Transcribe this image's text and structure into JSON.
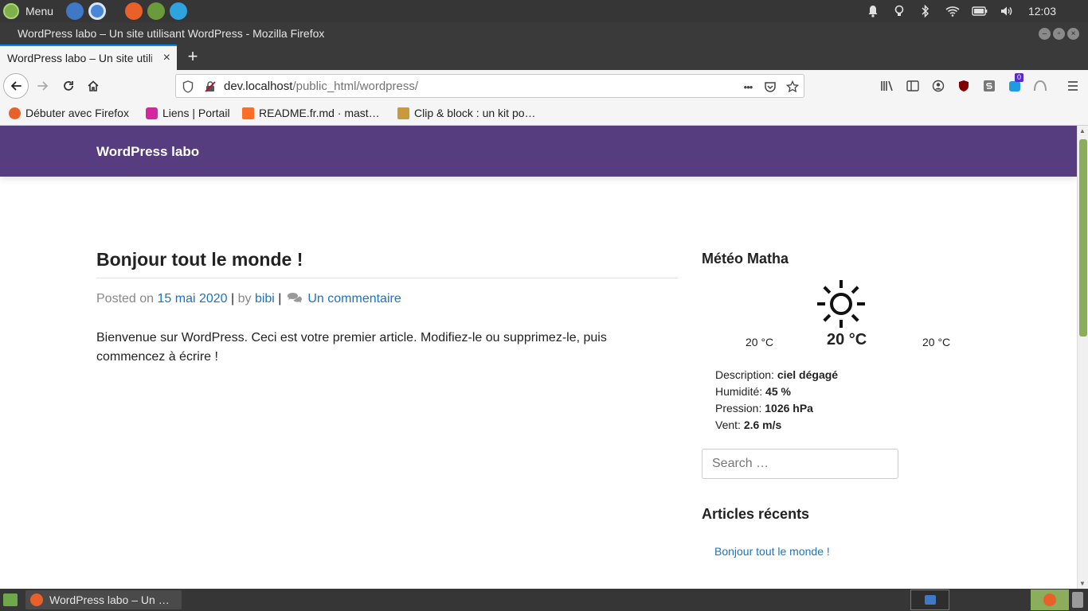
{
  "system_panel": {
    "menu_label": "Menu",
    "clock": "12:03"
  },
  "window": {
    "title": "WordPress labo – Un site utilisant WordPress - Mozilla Firefox"
  },
  "tabs": [
    {
      "label": "WordPress labo – Un site utilisant WordPress",
      "close": "×"
    }
  ],
  "new_tab_label": "+",
  "urlbar": {
    "host": "dev.localhost",
    "path": "/public_html/wordpress/",
    "more": "•••"
  },
  "bookmarks": [
    {
      "label": "Débuter avec Firefox"
    },
    {
      "label": "Liens | Portail"
    },
    {
      "label": "README.fr.md · mast…"
    },
    {
      "label": "Clip & block : un kit po…"
    }
  ],
  "toolbar": {
    "notification_badge": "0"
  },
  "site": {
    "title": "WordPress labo"
  },
  "post": {
    "title": "Bonjour tout le monde !",
    "meta_posted_on": "Posted on ",
    "date": "15 mai 2020",
    "meta_sep1": " | ",
    "meta_by": "by ",
    "author": "bibi",
    "meta_sep2": " | ",
    "comments": "Un commentaire",
    "body": "Bienvenue sur WordPress. Ceci est votre premier article. Modifiez-le ou supprimez-le, puis commencez à écrire !"
  },
  "weather_widget": {
    "title": "Météo Matha",
    "temp_min": "20 °C",
    "temp_now": "20 °C",
    "temp_max": "20 °C",
    "rows": [
      {
        "label": "Description: ",
        "value": "ciel dégagé"
      },
      {
        "label": "Humidité: ",
        "value": "45 %"
      },
      {
        "label": "Pression: ",
        "value": "1026 hPa"
      },
      {
        "label": "Vent: ",
        "value": "2.6 m/s"
      }
    ]
  },
  "search": {
    "placeholder": "Search …"
  },
  "recent_posts": {
    "title": "Articles récents",
    "items": [
      "Bonjour tout le monde !"
    ]
  },
  "taskbar": {
    "task_label": "WordPress labo – Un …"
  },
  "colors": {
    "site_header": "#553d80",
    "link": "#1e73be",
    "scrollbar_thumb": "#8bae5c",
    "tab_accent": "#0a84ff"
  }
}
